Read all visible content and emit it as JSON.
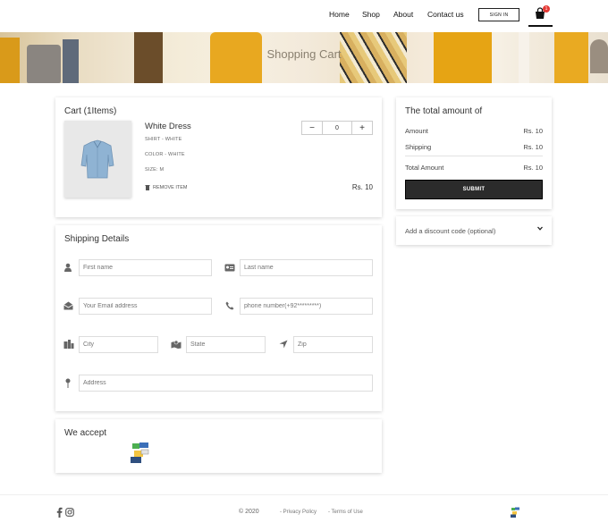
{
  "nav": {
    "links": [
      "Home",
      "Shop",
      "About",
      "Contact us"
    ],
    "signin_label": "SIGN IN",
    "cart_count": "1"
  },
  "hero": {
    "title": "Shopping Cart"
  },
  "cart": {
    "title": "Cart (1Items)",
    "item": {
      "name": "White Dress",
      "meta": [
        "SHIRT - WHITE",
        "COLOR - WHITE",
        "SIZE: M"
      ],
      "remove_label": "REMOVE ITEM",
      "price": "Rs. 10",
      "qty": "0",
      "minus": "−",
      "plus": "+"
    }
  },
  "shipping": {
    "title": "Shipping Details",
    "placeholders": {
      "first_name": "First name",
      "last_name": "Last name",
      "email": "Your Email address",
      "phone": "phone number(+92*********)",
      "city": "City",
      "state": "State",
      "zip": "Zip",
      "address": "Address"
    }
  },
  "accept": {
    "title": "We accept"
  },
  "total": {
    "title": "The total amount of",
    "rows": [
      {
        "label": "Amount",
        "value": "Rs. 10"
      },
      {
        "label": "Shipping",
        "value": "Rs. 10"
      },
      {
        "label": "Total Amount",
        "value": "Rs. 10"
      }
    ],
    "submit_label": "SUBMIT"
  },
  "discount": {
    "label": "Add a discount code (optional)"
  },
  "footer": {
    "copyright": "© 2020",
    "links": [
      "- Privacy Policy",
      "- Terms of Use"
    ]
  },
  "colors": {
    "accent_dark": "#2b2b2b",
    "badge": "#e53935",
    "hero_yellow": "#e8a820"
  }
}
